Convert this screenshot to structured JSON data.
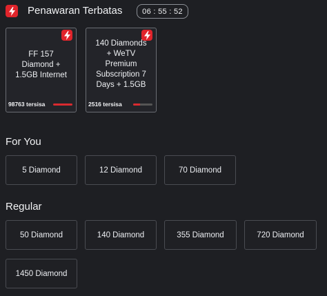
{
  "header": {
    "title": "Penawaran Terbatas",
    "timer": "06 : 55 : 52"
  },
  "flash_sale": [
    {
      "title_lines": [
        "FF 157",
        "Diamond +",
        "1.5GB Internet"
      ],
      "stock_text": "98763 tersisa",
      "stock_fraction": 1.0
    },
    {
      "title_lines": [
        "140 Diamonds",
        "+ WeTV",
        "Premium",
        "Subscription 7",
        "Days + 1.5GB"
      ],
      "stock_text": "2516 tersisa",
      "stock_fraction": 0.35
    }
  ],
  "for_you": {
    "title": "For You",
    "items": [
      "5 Diamond",
      "12 Diamond",
      "70 Diamond"
    ]
  },
  "regular": {
    "title": "Regular",
    "items": [
      "50 Diamond",
      "140 Diamond",
      "355 Diamond",
      "720 Diamond",
      "1450 Diamond"
    ]
  },
  "colors": {
    "accent": "#e0242b",
    "background": "#1e1f23",
    "card_border": "#4a4c52"
  },
  "icons": {
    "flash": "lightning-bolt-icon"
  }
}
